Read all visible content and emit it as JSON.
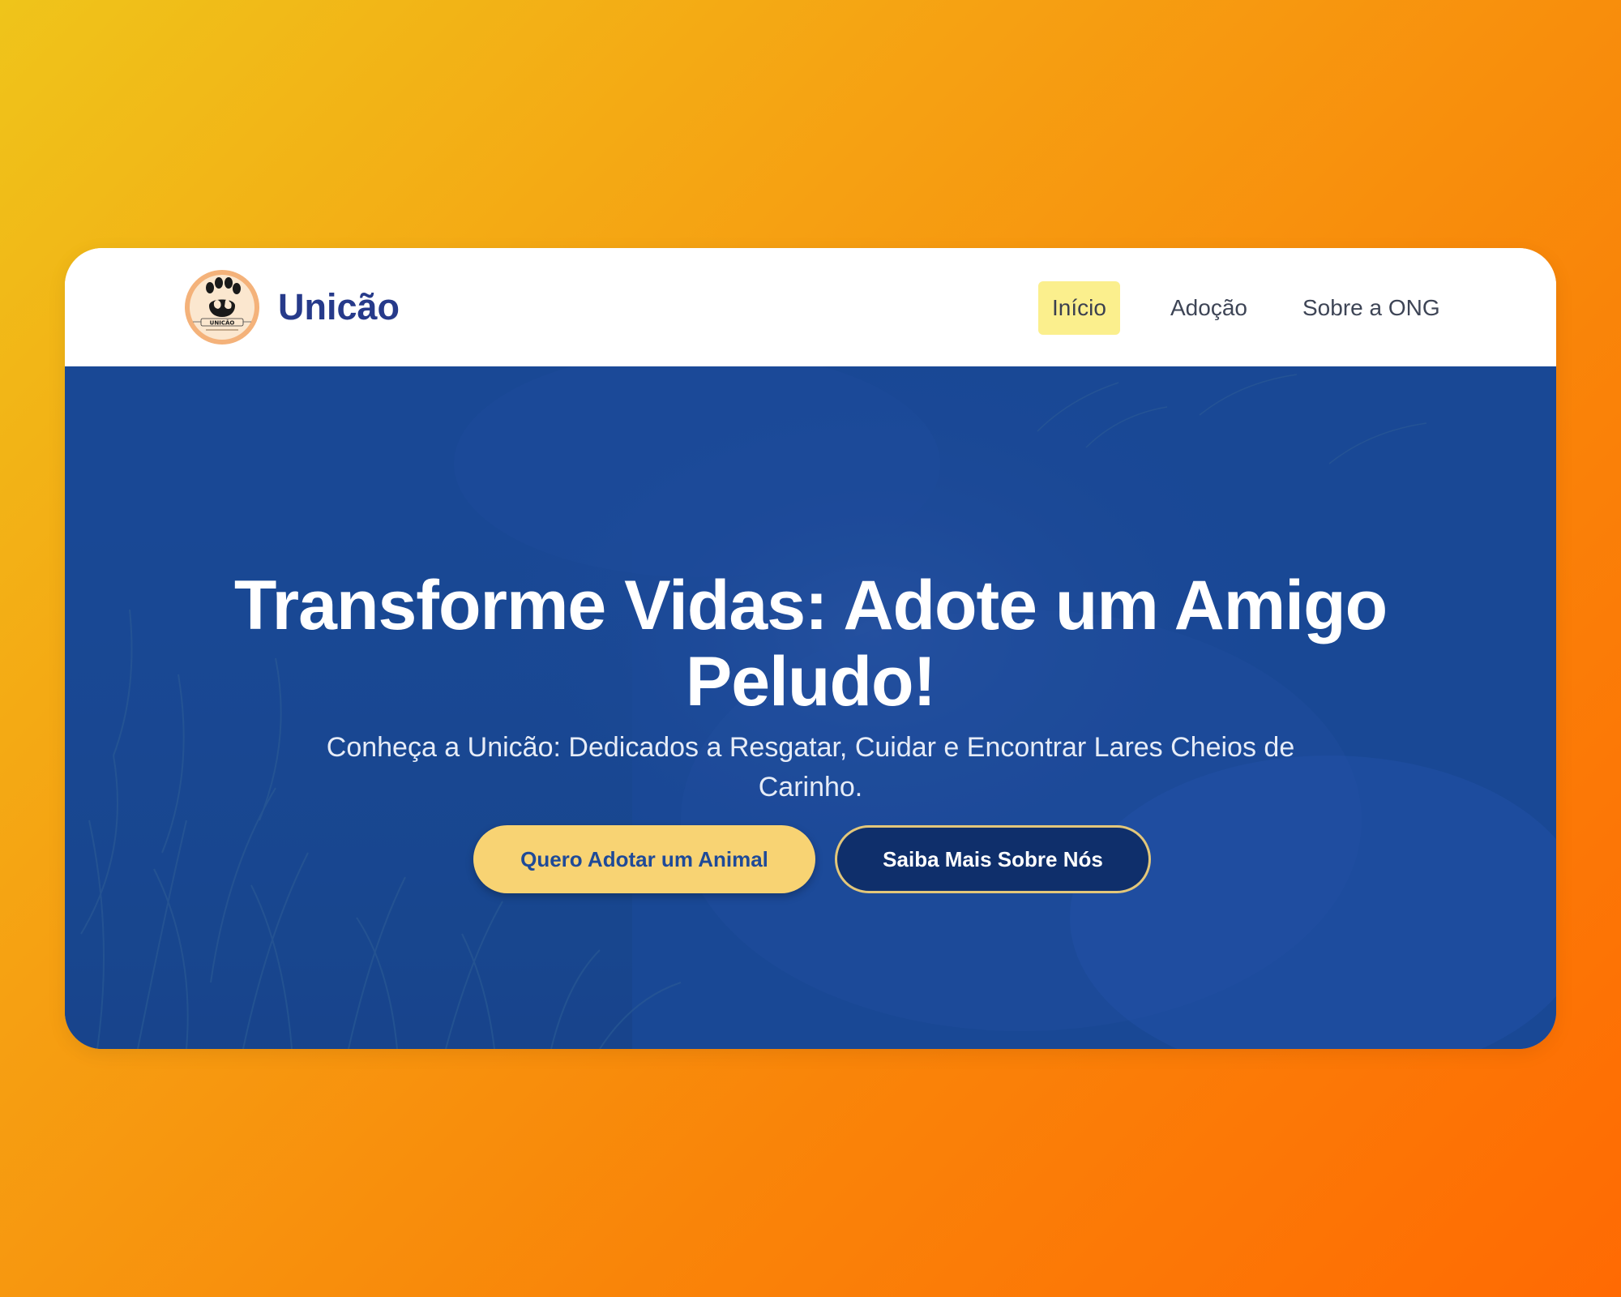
{
  "brand": {
    "name": "Unicão",
    "logo_icon": "paw-print-logo-icon"
  },
  "nav": {
    "items": [
      {
        "label": "Início",
        "active": true
      },
      {
        "label": "Adoção",
        "active": false
      },
      {
        "label": "Sobre a ONG",
        "active": false
      }
    ]
  },
  "hero": {
    "title": "Transforme Vidas: Adote um Amigo Peludo!",
    "subtitle": "Conheça a Unicão: Dedicados a Resgatar, Cuidar e Encontrar Lares Cheios de Carinho.",
    "primary_button": "Quero Adotar um Animal",
    "secondary_button": "Saiba Mais Sobre Nós",
    "background_image": "dog-lying-on-grass"
  },
  "colors": {
    "brand_blue": "#263a8a",
    "nav_active_bg": "#fbef8d",
    "hero_blue": "#1b4591",
    "primary_button_bg": "#f8d373",
    "secondary_button_bg": "#0f2f6b",
    "secondary_button_border": "#e3c77a"
  }
}
